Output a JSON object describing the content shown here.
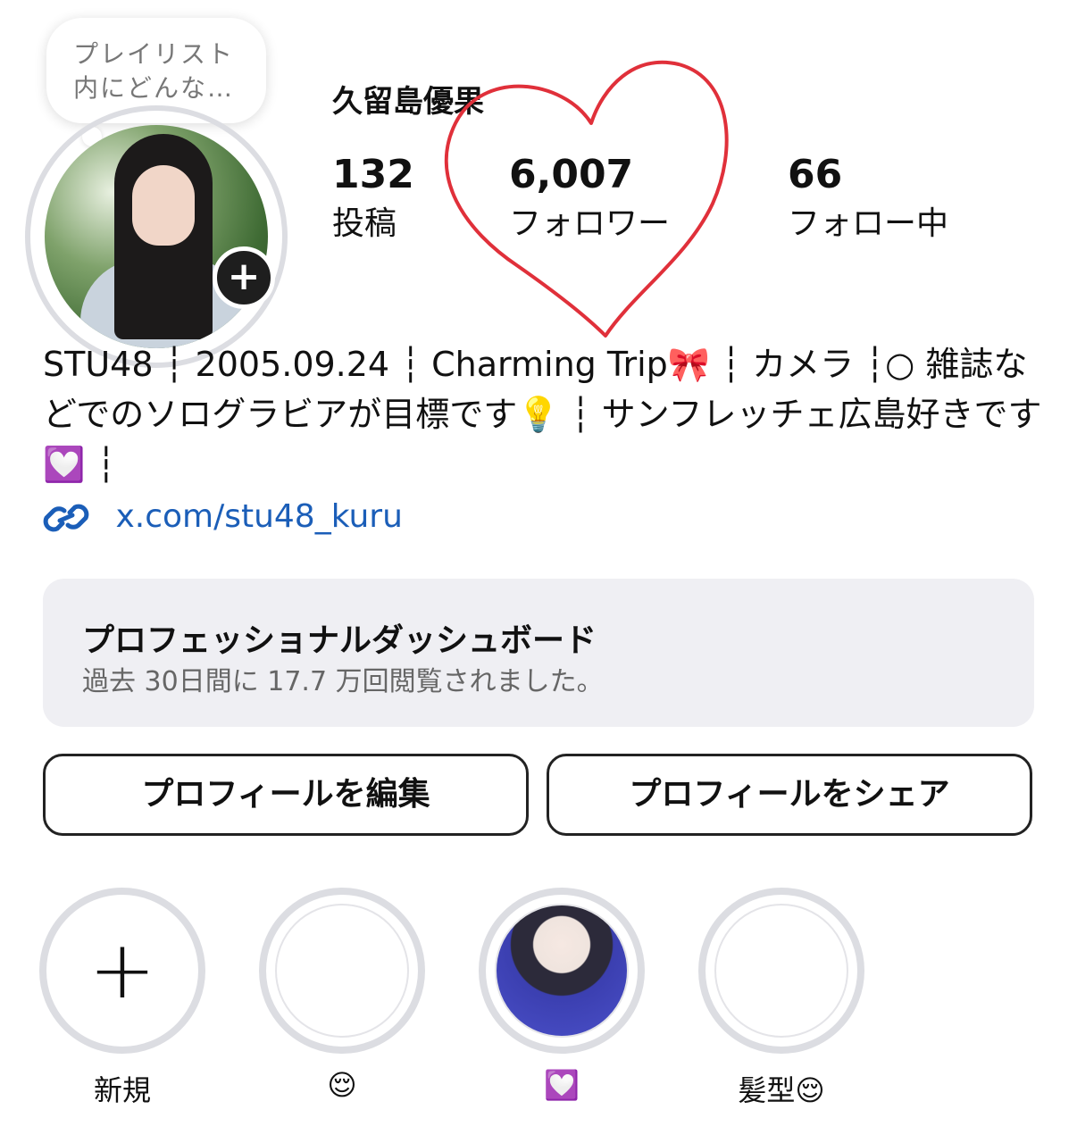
{
  "profile": {
    "note": "プレイリスト\n内にどんな…",
    "username": "久留島優果",
    "stats": [
      {
        "value": "132",
        "label": "投稿"
      },
      {
        "value": "6,007",
        "label": "フォロワー"
      },
      {
        "value": "66",
        "label": "フォロー中"
      }
    ],
    "bio": "STU48 ┆ 2005.09.24 ┆ Charming Trip🎀 ┆ カメラ ┆○ 雑誌などでのソログラビアが目標です💡 ┆ サンフレッチェ広島好きです💟 ┆",
    "link": "x.com/stu48_kuru",
    "add_badge": "+"
  },
  "dashboard": {
    "title": "プロフェッショナルダッシュボード",
    "subtitle": "過去 30日間に 17.7 万回閲覧されました。"
  },
  "buttons": {
    "edit": "プロフィールを編集",
    "share": "プロフィールをシェア"
  },
  "highlights": [
    {
      "label": "新規",
      "icon": "plus-icon"
    },
    {
      "label": "😌",
      "icon": "empty-cover"
    },
    {
      "label": "💟",
      "icon": "photo-cover"
    },
    {
      "label": "髪型😌",
      "icon": "empty-cover"
    }
  ],
  "colors": {
    "heart_annotation": "#e0303a",
    "link": "#1b5eb8",
    "ring": "#dcdde2"
  }
}
